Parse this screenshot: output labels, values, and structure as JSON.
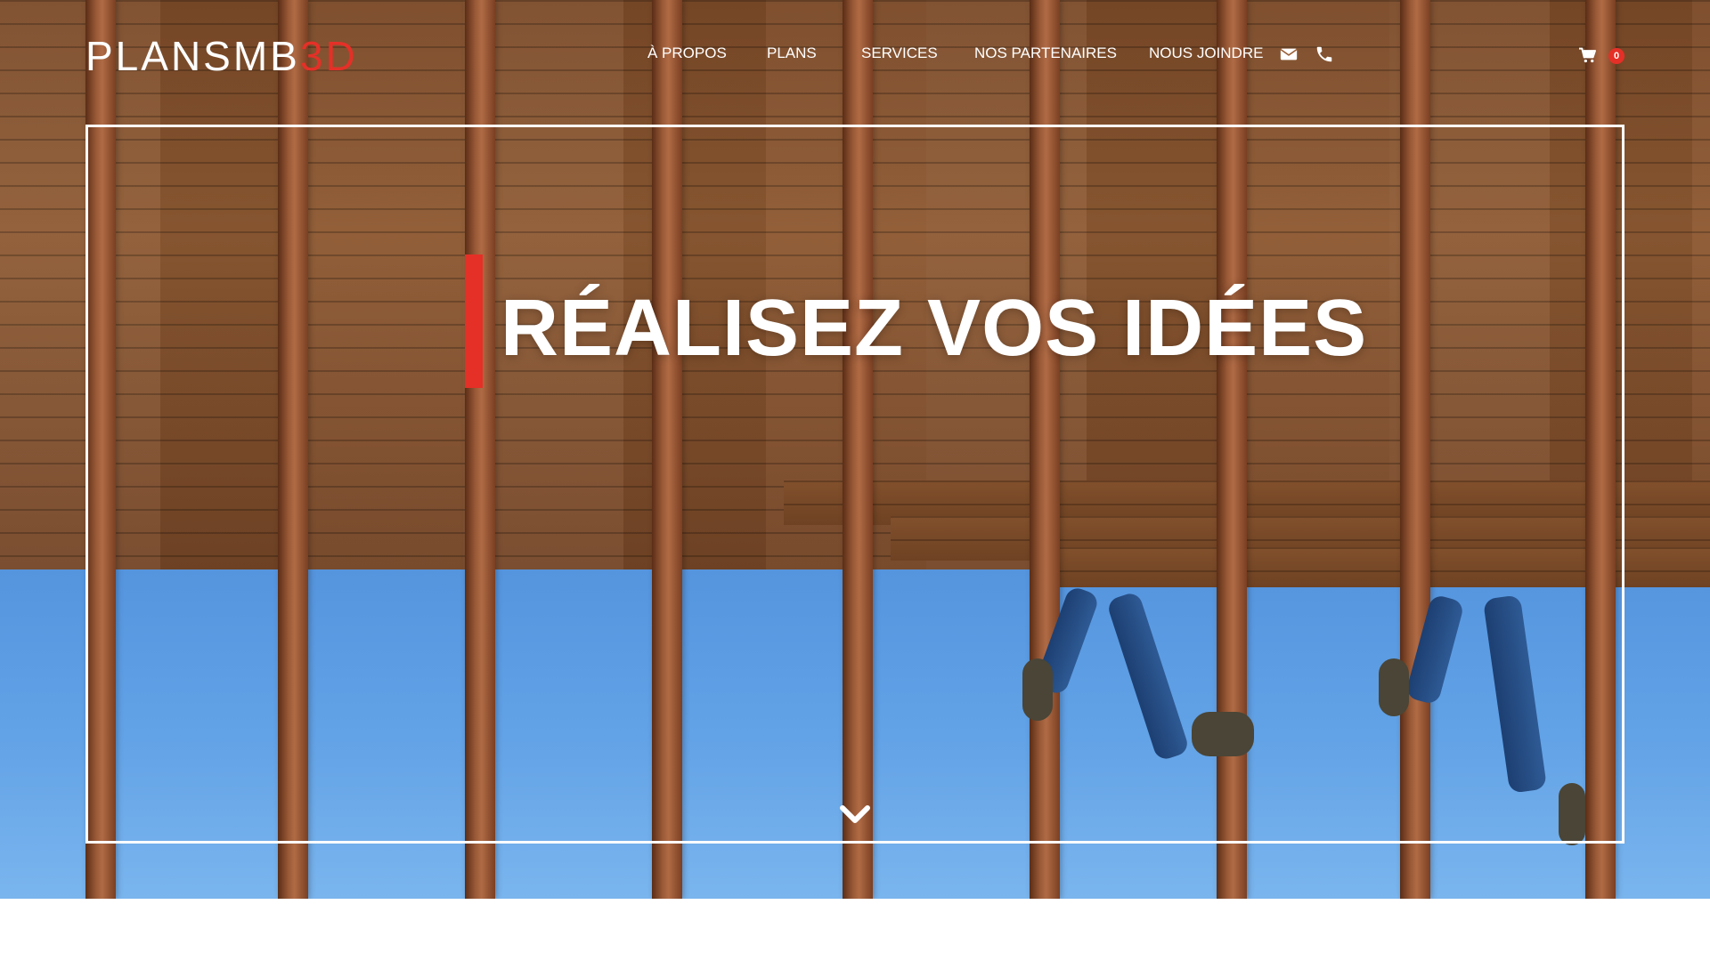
{
  "brand": {
    "logo_white": "PLANSMB",
    "logo_red": "3D",
    "accent_color": "#e53027"
  },
  "nav": {
    "items": [
      {
        "label": "À PROPOS"
      },
      {
        "label": "PLANS"
      },
      {
        "label": "SERVICES"
      },
      {
        "label": "NOS PARTENAIRES"
      },
      {
        "label": "NOUS JOINDRE"
      }
    ],
    "icons": [
      "envelope-icon",
      "phone-icon"
    ]
  },
  "cart": {
    "icon": "cart-icon",
    "count": "0"
  },
  "hero": {
    "headline": "RÉALISEZ VOS IDÉES",
    "scroll_icon": "chevron-down-icon"
  }
}
